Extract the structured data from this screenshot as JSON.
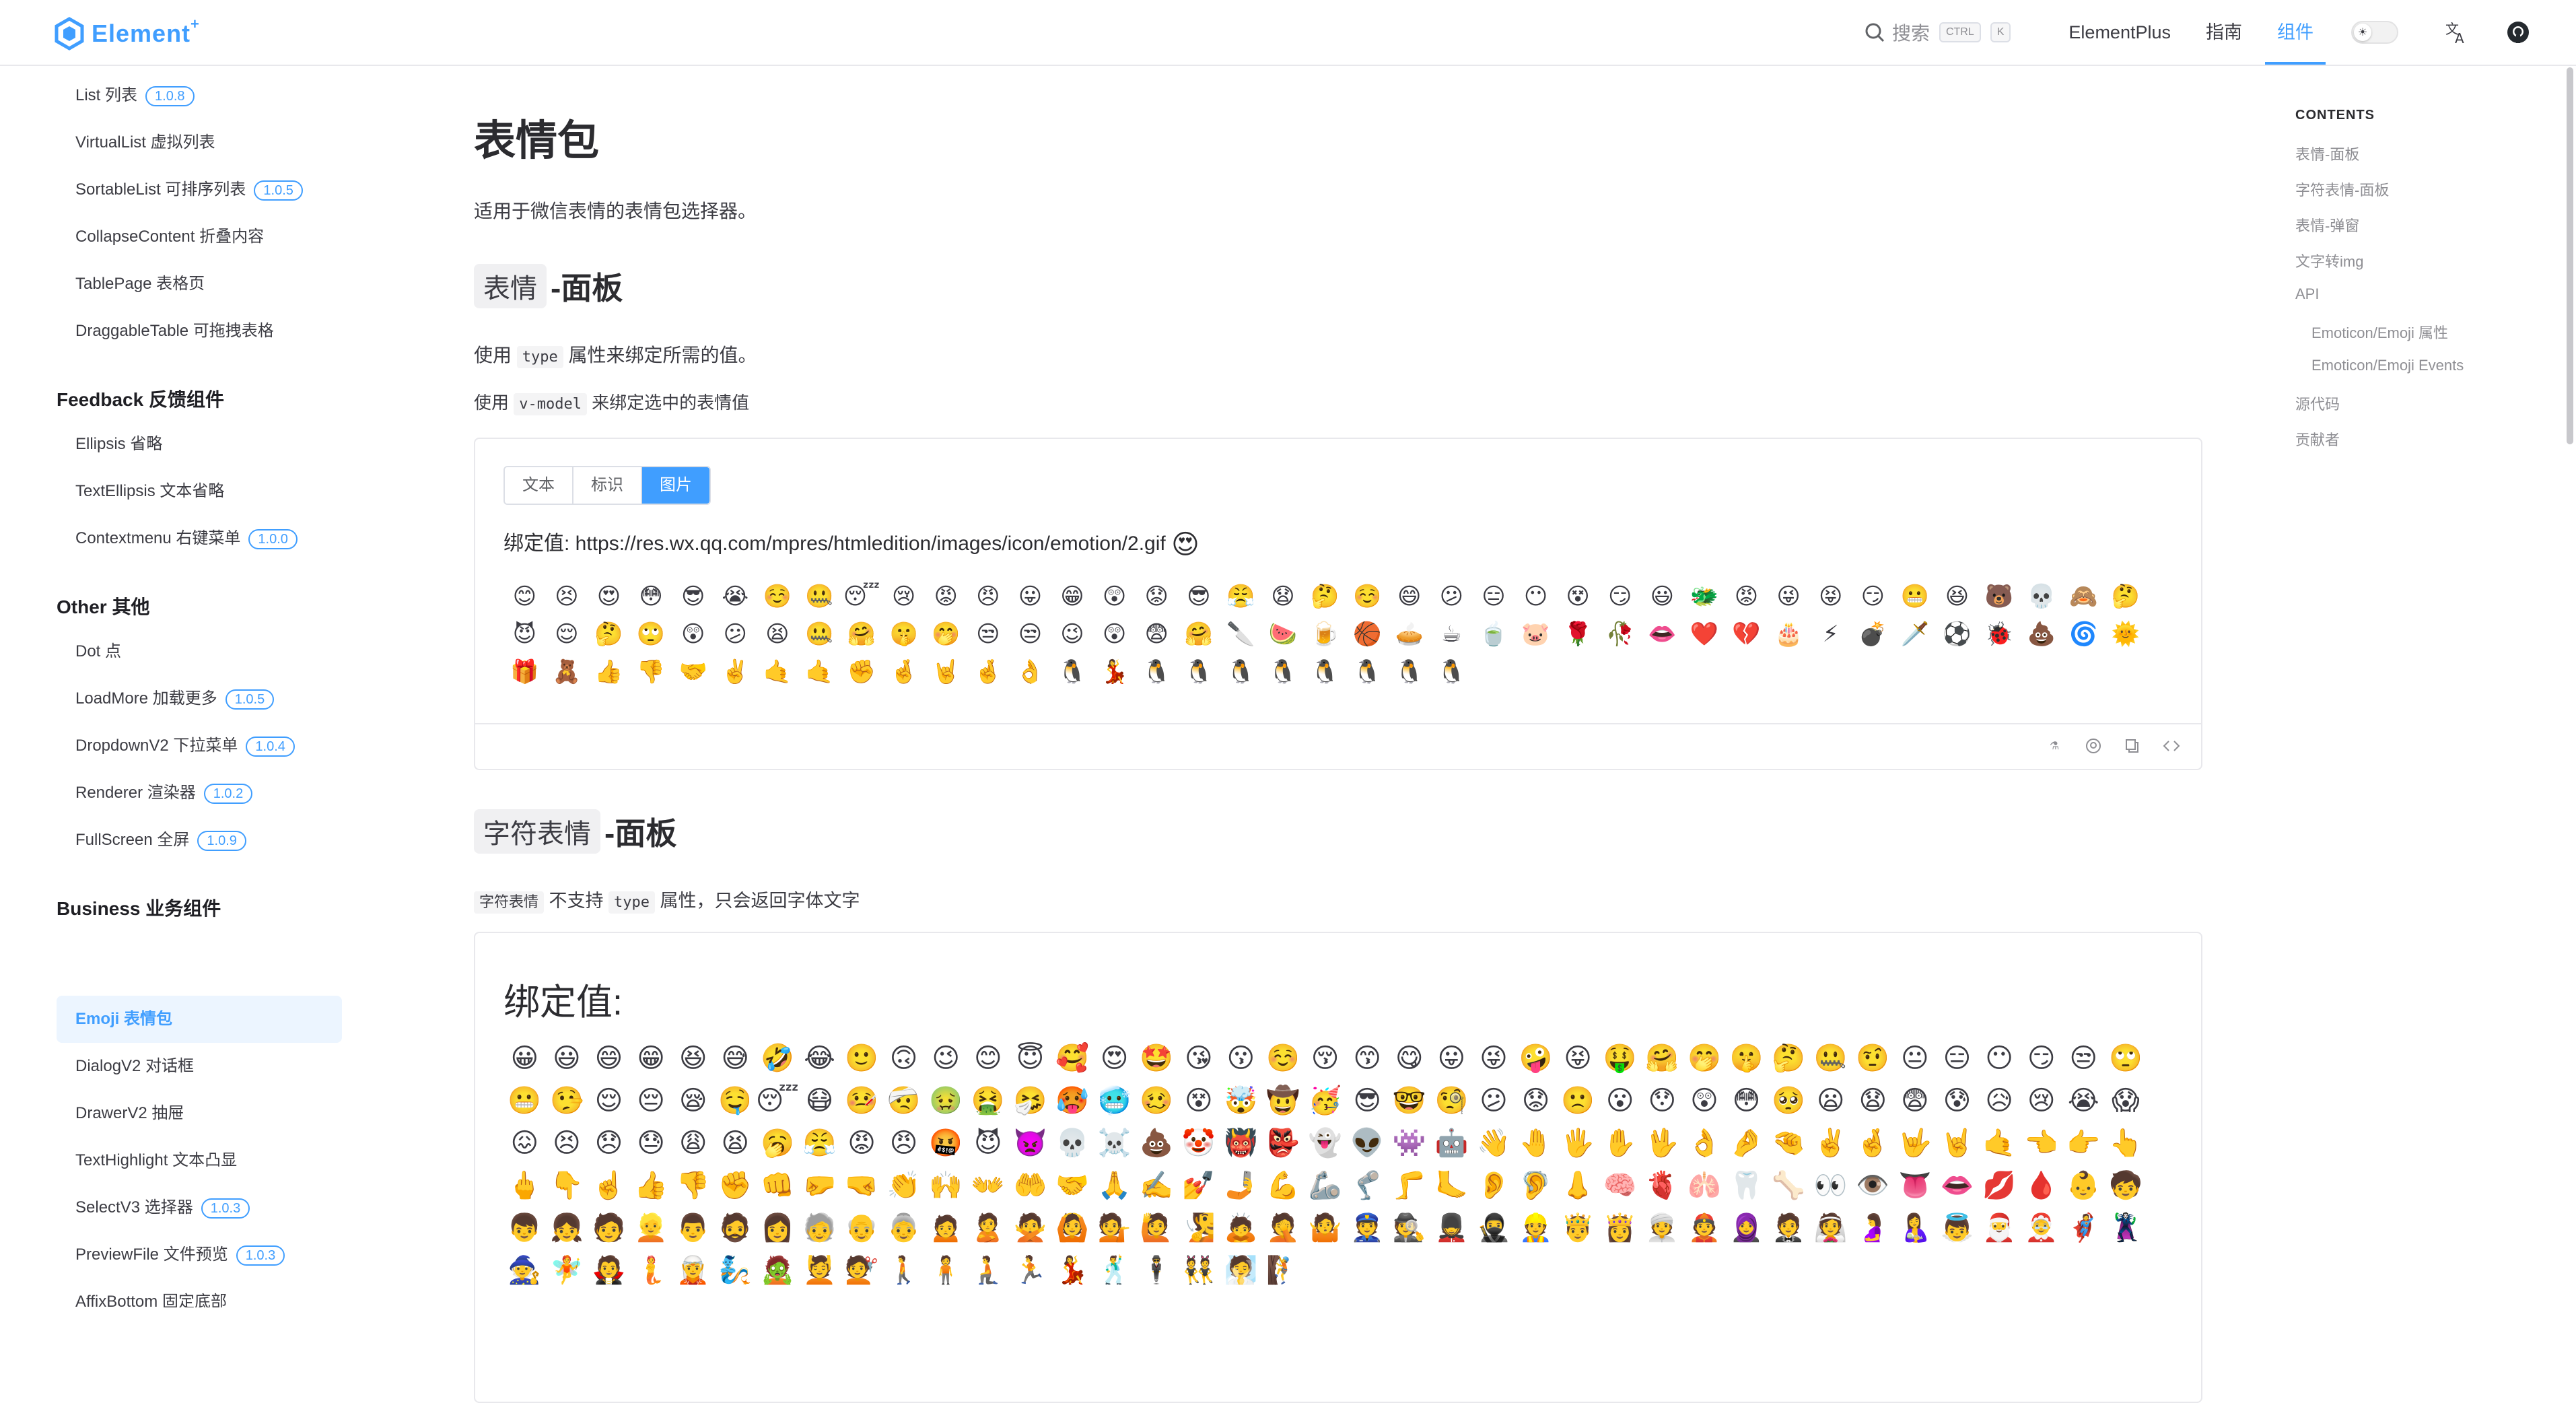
{
  "navbar": {
    "logo_text": "Element",
    "logo_plus": "+",
    "search_label": "搜索",
    "search_kbd1": "CTRL",
    "search_kbd2": "K",
    "links": [
      "ElementPlus",
      "指南",
      "组件"
    ],
    "active_link": "组件",
    "icons": [
      "search-icon",
      "sun-icon",
      "translate-icon",
      "github-icon"
    ],
    "accent": "#409eff"
  },
  "sidebar": {
    "items_top": [
      {
        "label": "List 列表",
        "badge": "1.0.8"
      },
      {
        "label": "VirtualList 虚拟列表",
        "badge": ""
      },
      {
        "label": "SortableList 可排序列表",
        "badge": "1.0.5"
      },
      {
        "label": "CollapseContent 折叠内容",
        "badge": ""
      },
      {
        "label": "TablePage 表格页",
        "badge": ""
      },
      {
        "label": "DraggableTable 可拖拽表格",
        "badge": ""
      }
    ],
    "group_feedback": "Feedback 反馈组件",
    "items_feedback": [
      {
        "label": "Ellipsis 省略",
        "badge": ""
      },
      {
        "label": "TextEllipsis 文本省略",
        "badge": ""
      },
      {
        "label": "Contextmenu 右键菜单",
        "badge": "1.0.0"
      }
    ],
    "group_other": "Other 其他",
    "items_other": [
      {
        "label": "Dot 点",
        "badge": ""
      },
      {
        "label": "LoadMore 加载更多",
        "badge": "1.0.5"
      },
      {
        "label": "DropdownV2 下拉菜单",
        "badge": "1.0.4"
      },
      {
        "label": "Renderer 渲染器",
        "badge": "1.0.2"
      },
      {
        "label": "FullScreen 全屏",
        "badge": "1.0.9"
      }
    ],
    "group_business": "Business 业务组件",
    "items_business": [
      {
        "label": "Emoji 表情包",
        "badge": "",
        "active": true
      },
      {
        "label": "DialogV2 对话框",
        "badge": ""
      },
      {
        "label": "DrawerV2 抽屉",
        "badge": ""
      },
      {
        "label": "TextHighlight 文本凸显",
        "badge": ""
      },
      {
        "label": "SelectV3 选择器",
        "badge": "1.0.3"
      },
      {
        "label": "PreviewFile 文件预览",
        "badge": "1.0.3"
      },
      {
        "label": "AffixBottom 固定底部",
        "badge": ""
      }
    ]
  },
  "main": {
    "title": "表情包",
    "intro": "适用于微信表情的表情包选择器。",
    "section1": {
      "code": "表情",
      "title_rest": "-面板",
      "line1_pre": "使用 ",
      "line1_code": "type",
      "line1_post": " 属性来绑定所需的值。",
      "line2_pre": "使用 ",
      "line2_code": "v-model",
      "line2_post": " 来绑定选中的表情值",
      "tabs": [
        "文本",
        "标识",
        "图片"
      ],
      "active_tab": "图片",
      "bound_label": "绑定值: ",
      "bound_value": "https://res.wx.qq.com/mpres/htmledition/images/icon/emotion/2.gif",
      "bound_emoji": "😍",
      "emojis": "😊😣😍😳😎😭☺️🤐😴😢😡😠😛😁😲😟😎😤😧🤔☺️😄😕😑😶😵😏😃🐲😡😜😝😏😬😆🐻💀🙈🤔😈😌🤔🙄😲😕😫🤐🤗🤫🤭😒😒😉😲😨🤗🔪🍉🍺🏀🥧☕🍵🐷🌹🥀👄❤️💔🎂⚡💣🗡️⚽🐞💩🌀🌞🎁🧸👍👎🤝✌️🤙🤙✊🤞🤘🤞👌🐧💃🐧🐧🐧🐧🐧🐧🐧🐧"
    },
    "section2": {
      "code": "字符表情",
      "title_rest": "-面板",
      "note_code": "字符表情",
      "note_mid": " 不支持 ",
      "note_code2": "type",
      "note_post": " 属性，只会返回字体文字",
      "bound_label": "绑定值:",
      "emojis": "😀😃😄😁😆😅🤣😂🙂🙃😉😊😇🥰😍🤩😘😗☺️😚😙😋😛😜🤪😝🤑🤗🤭🤫🤔🤐🤨😐😑😶😏😒🙄😬🤥😌😔😪🤤😴😷🤒🤕🤢🤮🤧🥵🥶🥴😵🤯🤠🥳😎🤓🧐😕😟🙁😮😯😲😳🥺😦😧😨😰😥😢😭😱😖😣😞😓😩😫🥱😤😡😠🤬😈👿💀☠️💩🤡👹👺👻👽👾🤖👋🤚🖐️✋🖖👌🤌🤏✌️🤞🤟🤘🤙👈👉👆🖕👇☝️👍👎✊👊🤛🤜👏🙌👐🤲🤝🙏✍️💅🤳💪🦾🦿🦵🦶👂🦻👃🧠🫀🫁🦷🦴👀👁️👅👄💋🩸👶🧒👦👧🧑👱👨🧔👩🧓👴👵🙍🙎🙅🙆💁🙋🧏🙇🤦🤷👮🕵️💂🥷👷🤴👸👳👲🧕🤵👰🤰🤱👼🎅🤶🦸🦹🧙🧚🧛🧜🧝🧞🧟💆💇🚶🧍🧎🏃💃🕺🕴️👯🧖🧗"
    }
  },
  "toc": {
    "title": "CONTENTS",
    "items": [
      "表情-面板",
      "字符表情-面板",
      "表情-弹窗",
      "文字转img",
      "API",
      "Emoticon/Emoji 属性",
      "Emoticon/Emoji Events",
      "源代码",
      "贡献者"
    ]
  },
  "demo_footer_icons": [
    "flask-icon",
    "github-icon",
    "copy-icon",
    "code-icon"
  ]
}
